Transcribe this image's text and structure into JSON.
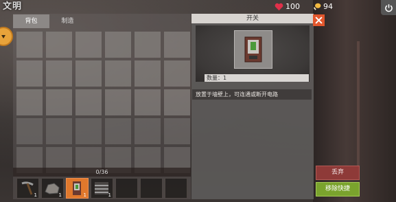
{
  "hud": {
    "logo_text": "文明",
    "health": "100",
    "food": "94",
    "icons": {
      "health": "heart-icon",
      "food": "drumstick-icon",
      "power": "power-icon"
    },
    "colors": {
      "heart": "#e0304a",
      "food": "#f2b940"
    }
  },
  "tabs": [
    {
      "label": "背包",
      "active": true
    },
    {
      "label": "制造",
      "active": false
    }
  ],
  "inventory": {
    "grid_cols": 6,
    "grid_rows": 5,
    "capacity": "0/36",
    "used": 0,
    "max": 36
  },
  "hotbar": [
    {
      "item": "pickaxe-icon",
      "qty": "1"
    },
    {
      "item": "rock-icon",
      "qty": "1"
    },
    {
      "item": "switch-icon",
      "qty": "1",
      "selected": true
    },
    {
      "item": "fence-icon",
      "qty": "1"
    },
    {
      "item": "",
      "qty": ""
    },
    {
      "item": "",
      "qty": ""
    },
    {
      "item": "",
      "qty": ""
    }
  ],
  "detail": {
    "title": "开关",
    "quantity_label": "数量：1",
    "description": "放置于墙壁上，可连通或断开电路",
    "item_icon": "switch-icon"
  },
  "buttons": {
    "discard": "丢弃",
    "remove_quick": "移除快捷"
  },
  "colors": {
    "selected_slot": "#e0782c",
    "discard": "#8e3a38",
    "remove_quick": "#7aa32d",
    "close": "#e2572d"
  }
}
